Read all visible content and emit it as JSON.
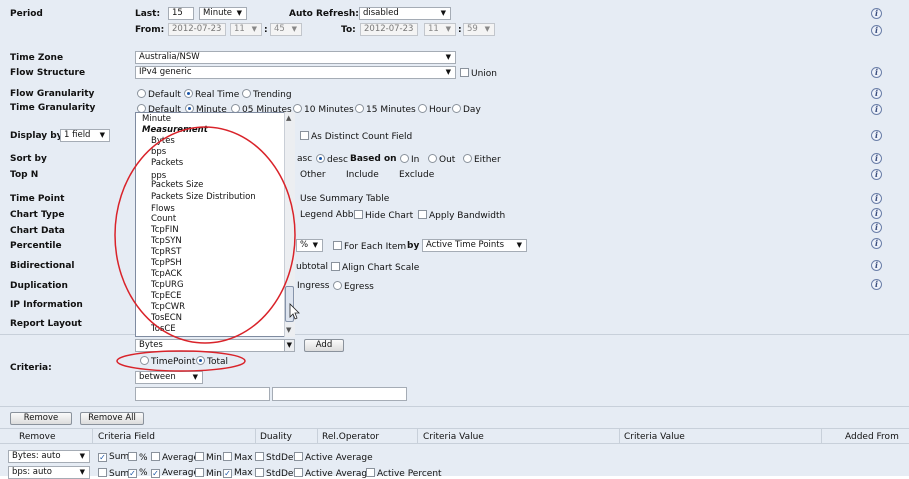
{
  "period": {
    "label": "Period",
    "last_label": "Last:",
    "last_value": "15",
    "last_unit": "Minute",
    "auto_refresh_label": "Auto Refresh:",
    "auto_refresh_value": "disabled",
    "from_label": "From:",
    "from_date": "2012-07-23",
    "from_hour": "11",
    "from_minute": "45",
    "to_label": "To:",
    "to_date": "2012-07-23",
    "to_hour": "11",
    "to_minute": "59",
    "colon": ":"
  },
  "time_zone": {
    "label": "Time Zone",
    "value": "Australia/NSW"
  },
  "flow_structure": {
    "label": "Flow Structure",
    "value": "IPv4 generic",
    "union_label": "Union"
  },
  "flow_granularity": {
    "label": "Flow Granularity",
    "options": [
      "Default",
      "Real Time",
      "Trending"
    ],
    "selected": "Real Time"
  },
  "time_granularity": {
    "label": "Time Granularity",
    "options": [
      "Default",
      "Minute",
      "05 Minutes",
      "10 Minutes",
      "15 Minutes",
      "Hour",
      "Day"
    ],
    "selected": "Minute"
  },
  "display_by": {
    "label": "Display by",
    "value": "1 field",
    "distinct_label": "As Distinct Count Field"
  },
  "sort_by": {
    "label": "Sort by",
    "asc": "asc",
    "desc": "desc",
    "based_on": "Based on",
    "in": "In",
    "out": "Out",
    "either": "Either"
  },
  "top_n": {
    "label": "Top N",
    "other": "Other",
    "include": "Include",
    "exclude": "Exclude"
  },
  "time_point": {
    "label": "Time Point",
    "summary_label": "Use Summary Table"
  },
  "chart_type": {
    "label": "Chart Type",
    "legend_abbr": "Legend Abbr",
    "hide_chart": "Hide Chart",
    "apply_bandwidth": "Apply Bandwidth"
  },
  "chart_data": {
    "label": "Chart Data"
  },
  "percentile": {
    "label": "Percentile",
    "pct_select": "%",
    "for_each_item": "For Each Item",
    "by_label": "by",
    "by_value": "Active Time Points"
  },
  "bidirectional": {
    "label": "Bidirectional",
    "subtotal": "ubtotal",
    "align_scale": "Align Chart Scale"
  },
  "duplication": {
    "label": "Duplication",
    "ingress": "Ingress",
    "egress": "Egress"
  },
  "ip_information": {
    "label": "IP Information"
  },
  "report_layout": {
    "label": "Report Layout"
  },
  "dropdown": {
    "items": [
      "Minute",
      "Measurement",
      "Bytes",
      "bps",
      "Packets",
      "pps",
      "Packets Size",
      "Packets Size Distribution",
      "Flows",
      "Count",
      "TcpFIN",
      "TcpSYN",
      "TcpRST",
      "TcpPSH",
      "TcpACK",
      "TcpURG",
      "TcpECE",
      "TcpCWR",
      "TosECN",
      "TosCE"
    ]
  },
  "criteria": {
    "label": "Criteria:",
    "field_value": "Bytes",
    "add_label": "Add",
    "timepoint_label": "TimePoint",
    "total_label": "Total",
    "operator": "between"
  },
  "buttons": {
    "remove": "Remove",
    "remove_all": "Remove All"
  },
  "table": {
    "headers": [
      "Remove",
      "Criteria Field",
      "Duality",
      "Rel.Operator",
      "Criteria Value",
      "Criteria Value",
      "Added From"
    ],
    "rows": [
      {
        "field": "Bytes: auto",
        "checks": [
          [
            "Sum",
            true
          ],
          [
            "%",
            false
          ],
          [
            "Average",
            false
          ],
          [
            "Min",
            false
          ],
          [
            "Max",
            false
          ],
          [
            "StdDev",
            false
          ],
          [
            "Active Average",
            false
          ]
        ]
      },
      {
        "field": "bps: auto",
        "checks": [
          [
            "Sum",
            false
          ],
          [
            "%",
            true
          ],
          [
            "Average",
            true
          ],
          [
            "Min",
            false
          ],
          [
            "Max",
            true
          ],
          [
            "StdDev",
            false
          ],
          [
            "Active Average",
            false
          ],
          [
            "Active Percent",
            false
          ]
        ]
      }
    ]
  },
  "help_icon": "i",
  "colors": {
    "panel": "#e6ecf4",
    "annotation": "#d9232a",
    "accent": "#1b56a8"
  }
}
